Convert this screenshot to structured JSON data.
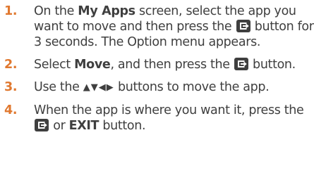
{
  "steps": [
    {
      "number": "1.",
      "text_a": "On the ",
      "bold_a": "My Apps",
      "text_b": " screen, select the app you want to move and then press the ",
      "icon": "enter-button-icon",
      "text_c": " button for 3 seconds. The Option menu appears."
    },
    {
      "number": "2.",
      "text_a": "Select ",
      "bold_a": "Move",
      "text_b": ", and then press the ",
      "icon": "enter-button-icon",
      "text_c": " button."
    },
    {
      "number": "3.",
      "text_a": "Use the ",
      "arrows": "▲▼◀▶",
      "text_b": " buttons to move the app."
    },
    {
      "number": "4.",
      "text_a": "When the app is where you want it, press the ",
      "icon": "enter-button-icon",
      "text_b": " or ",
      "bold_a": "EXIT",
      "text_c": " button."
    }
  ],
  "colors": {
    "step_number": "#e0782f",
    "body_text": "#3f3f3f",
    "icon_fill": "#3f3f3f"
  }
}
